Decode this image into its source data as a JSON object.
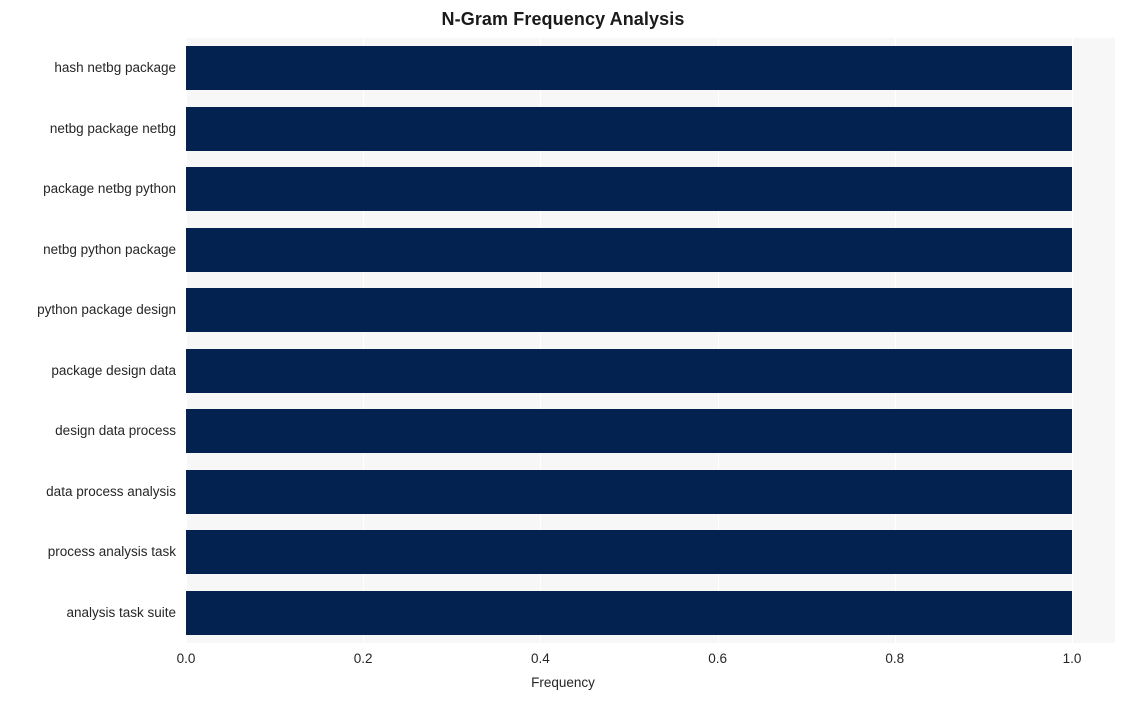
{
  "chart_data": {
    "type": "bar",
    "orientation": "horizontal",
    "title": "N-Gram Frequency Analysis",
    "xlabel": "Frequency",
    "ylabel": "",
    "xlim": [
      0.0,
      1.0
    ],
    "xticks": [
      "0.0",
      "0.2",
      "0.4",
      "0.6",
      "0.8",
      "1.0"
    ],
    "xtick_values": [
      0.0,
      0.2,
      0.4,
      0.6,
      0.8,
      1.0
    ],
    "grid": true,
    "grid_axis": "x",
    "legend": null,
    "categories": [
      "hash netbg package",
      "netbg package netbg",
      "package netbg python",
      "netbg python package",
      "python package design",
      "package design data",
      "design data process",
      "data process analysis",
      "process analysis task",
      "analysis task suite"
    ],
    "values": [
      1.0,
      1.0,
      1.0,
      1.0,
      1.0,
      1.0,
      1.0,
      1.0,
      1.0,
      1.0
    ],
    "bar_color": "#032250",
    "plot_background": "#f7f7f7",
    "gridline_color": "#ffffff",
    "figure_background": "#ffffff",
    "text_color": "#262626",
    "title_color": "#1a1a1a"
  }
}
